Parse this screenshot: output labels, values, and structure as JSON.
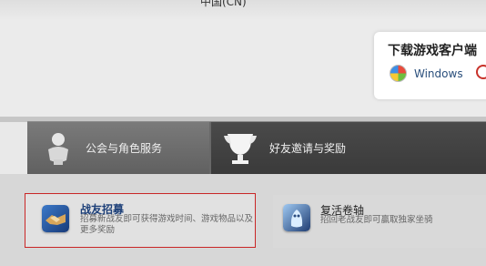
{
  "top": {
    "language_text": "中国(CN)"
  },
  "client_box": {
    "title": "下载游戏客户端",
    "windows_label": "Windows"
  },
  "tabs": [
    {
      "label": "公会与角色服务",
      "icon": "character-icon"
    },
    {
      "label": "好友邀请与奖励",
      "icon": "trophy-icon"
    }
  ],
  "cards": [
    {
      "title": "战友招募",
      "description": "招募新战友即可获得游戏时间、游戏物品以及更多奖励",
      "icon": "handshake-icon"
    },
    {
      "title": "复活卷轴",
      "description": "招回老战友即可赢取独家坐骑",
      "icon": "ghost-mount-icon"
    }
  ]
}
